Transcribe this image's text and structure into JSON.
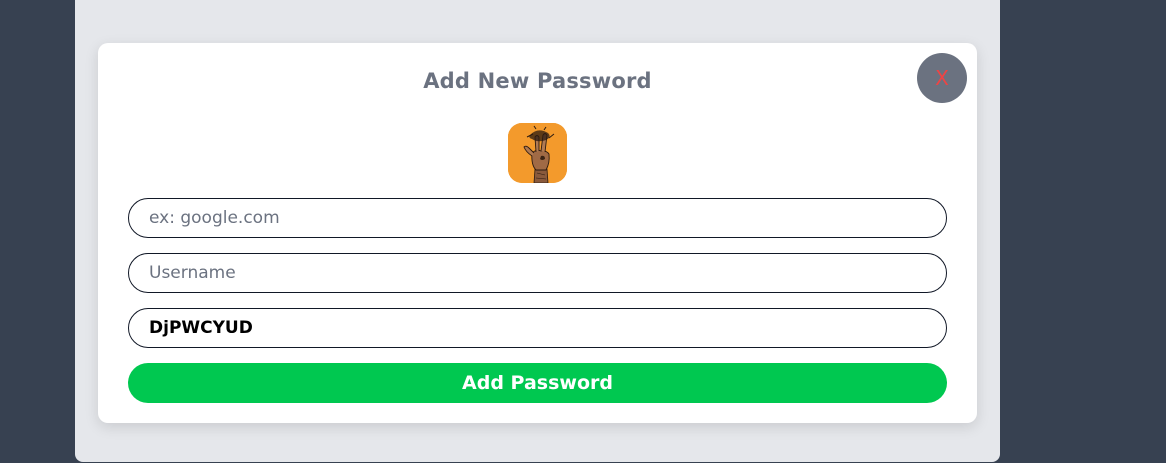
{
  "modal": {
    "title": "Add New Password",
    "close_label": "X"
  },
  "form": {
    "website_placeholder": "ex: google.com",
    "website_value": "",
    "username_placeholder": "Username",
    "username_value": "",
    "password_value": "DjPWCYUD",
    "submit_label": "Add Password"
  },
  "icons": {
    "site_icon": "hand-illustration-icon"
  },
  "colors": {
    "page_background": "#374151",
    "panel_background": "#e5e7eb",
    "modal_background": "#ffffff",
    "title_text": "#6b7280",
    "close_button_bg": "#6b7280",
    "close_button_text": "#ef4444",
    "site_icon_bg": "#f39a2c",
    "submit_button_bg": "#00c850",
    "submit_button_text": "#ffffff"
  }
}
